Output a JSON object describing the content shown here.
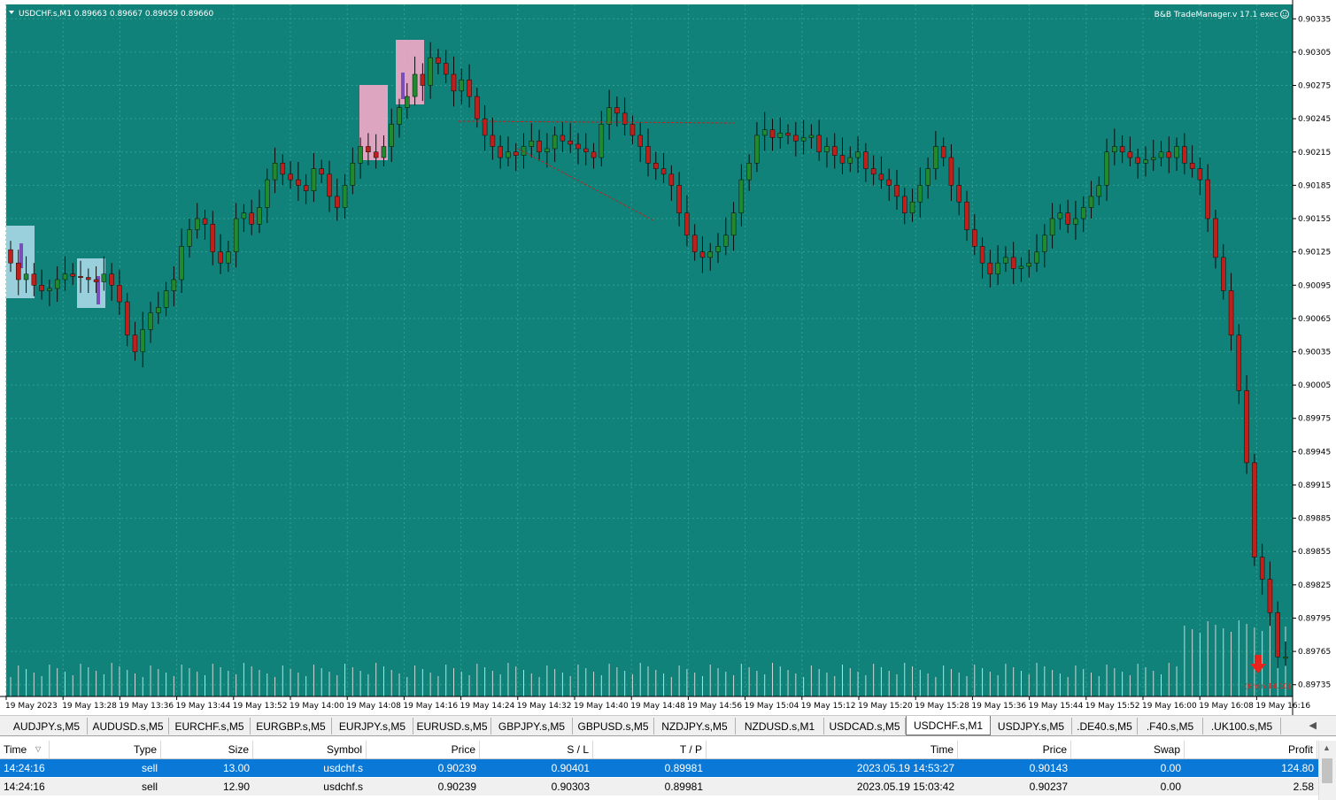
{
  "chart": {
    "symbol_info": "USDCHF.s,M1  0.89663 0.89667 0.89659 0.89660",
    "ea_label": "B&B TradeManager.v 17.1 exec",
    "smiley_icon": "smiley-icon",
    "marker_label": "(6min 14.10)",
    "colors": {
      "background": "#118279",
      "grid": "#2fa093",
      "bull": "#1f8a2e",
      "bear": "#c0201c",
      "wick": "#0a0a0a",
      "volume": "#c7d8d6",
      "zone_blue": "#aad8e6",
      "zone_pink": "#f4a9c6",
      "candle_purple": "#7a4fb8",
      "arrow": "#e8231c"
    },
    "price_labels": [
      "0.90335",
      "0.90305",
      "0.90275",
      "0.90245",
      "0.90215",
      "0.90185",
      "0.90155",
      "0.90125",
      "0.90095",
      "0.90065",
      "0.90035",
      "0.90005",
      "0.89975",
      "0.89945",
      "0.89915",
      "0.89885",
      "0.89855",
      "0.89825",
      "0.89795",
      "0.89765",
      "0.89735"
    ],
    "time_labels": [
      "19 May 2023",
      "19 May 13:28",
      "19 May 13:36",
      "19 May 13:44",
      "19 May 13:52",
      "19 May 14:00",
      "19 May 14:08",
      "19 May 14:16",
      "19 May 14:24",
      "19 May 14:32",
      "19 May 14:40",
      "19 May 14:48",
      "19 May 14:56",
      "19 May 15:04",
      "19 May 15:12",
      "19 May 15:20",
      "19 May 15:28",
      "19 May 15:36",
      "19 May 15:44",
      "19 May 15:52",
      "19 May 16:00",
      "19 May 16:08",
      "19 May 16:16"
    ]
  },
  "chart_data": {
    "type": "candlestick",
    "symbol": "USDCHF.s",
    "timeframe": "M1",
    "ylim": [
      0.8973,
      0.9034
    ],
    "close_series": [
      0.90115,
      0.901,
      0.90105,
      0.90095,
      0.9009,
      0.90092,
      0.901,
      0.90105,
      0.90103,
      0.90102,
      0.901,
      0.90098,
      0.90105,
      0.90095,
      0.9008,
      0.9005,
      0.90035,
      0.90055,
      0.9007,
      0.90075,
      0.9009,
      0.901,
      0.9013,
      0.90145,
      0.90155,
      0.9015,
      0.90125,
      0.90115,
      0.90125,
      0.90155,
      0.9016,
      0.9015,
      0.90165,
      0.9019,
      0.90205,
      0.90195,
      0.9019,
      0.90185,
      0.9018,
      0.902,
      0.90195,
      0.90175,
      0.90165,
      0.90185,
      0.90205,
      0.9022,
      0.90215,
      0.9021,
      0.9022,
      0.9024,
      0.90255,
      0.90265,
      0.90285,
      0.90275,
      0.903,
      0.90295,
      0.90285,
      0.9027,
      0.9028,
      0.90265,
      0.90245,
      0.9023,
      0.9022,
      0.9021,
      0.90215,
      0.90212,
      0.9022,
      0.90225,
      0.90215,
      0.90218,
      0.9023,
      0.90225,
      0.90222,
      0.90218,
      0.90215,
      0.9021,
      0.9024,
      0.90255,
      0.9025,
      0.9024,
      0.9023,
      0.9022,
      0.90205,
      0.902,
      0.90195,
      0.90185,
      0.9016,
      0.9014,
      0.90125,
      0.9012,
      0.90125,
      0.9013,
      0.9014,
      0.9016,
      0.9019,
      0.90205,
      0.9023,
      0.90235,
      0.90228,
      0.90232,
      0.9023,
      0.90225,
      0.90228,
      0.9023,
      0.90215,
      0.9022,
      0.90212,
      0.90205,
      0.9021,
      0.90215,
      0.902,
      0.90195,
      0.9019,
      0.90185,
      0.90175,
      0.9016,
      0.9017,
      0.90185,
      0.902,
      0.9022,
      0.9021,
      0.90185,
      0.9017,
      0.90145,
      0.9013,
      0.90115,
      0.90105,
      0.90115,
      0.9012,
      0.9011,
      0.90112,
      0.90115,
      0.90125,
      0.9014,
      0.90155,
      0.9016,
      0.9015,
      0.90155,
      0.90165,
      0.90175,
      0.90185,
      0.90215,
      0.9022,
      0.90215,
      0.9021,
      0.90205,
      0.90208,
      0.9021,
      0.90215,
      0.9021,
      0.9022,
      0.90205,
      0.902,
      0.9019,
      0.90155,
      0.9012,
      0.9009,
      0.9005,
      0.9,
      0.89935,
      0.8985,
      0.8983,
      0.898,
      0.8976,
      0.8976
    ],
    "overlay_price_labels": [
      "0.89663",
      "0.89667",
      "0.89659",
      "0.89660"
    ]
  },
  "tabs": [
    "AUDJPY.s,M5",
    "AUDUSD.s,M5",
    "EURCHF.s,M5",
    "EURGBP.s,M5",
    "EURJPY.s,M5",
    "EURUSD.s,M5",
    "GBPJPY.s,M5",
    "GBPUSD.s,M5",
    "NZDJPY.s,M5",
    "NZDUSD.s,M1",
    "USDCAD.s,M5",
    "USDCHF.s,M1",
    "USDJPY.s,M5",
    ".DE40.s,M5",
    ".F40.s,M5",
    ".UK100.s,M5"
  ],
  "active_tab": "USDCHF.s,M1",
  "terminal": {
    "columns": [
      "Time",
      "Type",
      "Size",
      "Symbol",
      "Price",
      "S / L",
      "T / P",
      "Time",
      "Price",
      "Swap",
      "Profit"
    ],
    "rows": [
      [
        "14:24:16",
        "sell",
        "13.00",
        "usdchf.s",
        "0.90239",
        "0.90401",
        "0.89981",
        "2023.05.19 14:53:27",
        "0.90143",
        "0.00",
        "124.80"
      ],
      [
        "14:24:16",
        "sell",
        "12.90",
        "usdchf.s",
        "0.90239",
        "0.90303",
        "0.89981",
        "2023.05.19 15:03:42",
        "0.90237",
        "0.00",
        "2.58"
      ]
    ]
  }
}
